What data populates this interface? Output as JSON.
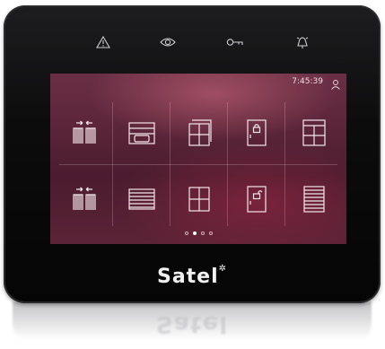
{
  "device": {
    "brand": "Satel",
    "brand_mark": "✲"
  },
  "top_bar": {
    "icons": [
      "warning-icon",
      "eye-icon",
      "key-icon",
      "fire-alarm-bell-icon"
    ]
  },
  "status_bar": {
    "time": "7:45:39",
    "user_icon": "user-icon"
  },
  "tiles": [
    {
      "icon": "gate-icon"
    },
    {
      "icon": "garage-door-icon"
    },
    {
      "icon": "window-icon"
    },
    {
      "icon": "door-locked-icon"
    },
    {
      "icon": "window-blind-icon"
    },
    {
      "icon": "gate-icon"
    },
    {
      "icon": "roller-shutter-icon"
    },
    {
      "icon": "window-icon"
    },
    {
      "icon": "door-unlocked-icon"
    },
    {
      "icon": "roller-shutter-icon"
    }
  ],
  "pagination": {
    "pages": 4,
    "active": 2
  },
  "colors": {
    "screen_top": "#6a2f45",
    "screen_bottom": "#4a1c2e",
    "frame": "#0c0c0d",
    "icon_stroke": "#f4e6ea"
  }
}
